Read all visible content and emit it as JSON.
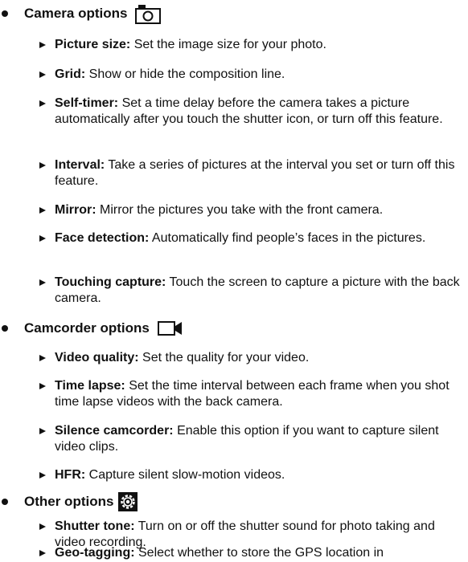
{
  "sections": [
    {
      "title": "Camera options",
      "icon": "camera-icon",
      "items": [
        {
          "label": "Picture size:",
          "text": " Set the image size for your photo."
        },
        {
          "label": "Grid:",
          "text": " Show or hide the composition line."
        },
        {
          "label": "Self-timer:",
          "text": " Set a time delay before the camera takes a picture automatically after you touch the shutter icon, or turn off this feature."
        },
        {
          "label": "Interval:",
          "text": " Take a series of pictures at the interval you set or turn off this feature."
        },
        {
          "label": "Mirror:",
          "text": " Mirror the pictures you take with the front camera."
        },
        {
          "label": "Face detection:",
          "text": " Automatically find people’s faces in the pictures."
        },
        {
          "label": "Touching capture:",
          "text": " Touch the screen to capture a picture with the back camera."
        }
      ]
    },
    {
      "title": "Camcorder options",
      "icon": "camcorder-icon",
      "items": [
        {
          "label": "Video quality:",
          "text": " Set the quality for your video."
        },
        {
          "label": "Time lapse:",
          "text": " Set the time interval between each frame when you shot time lapse videos with the back camera."
        },
        {
          "label": "Silence camcorder:",
          "text": " Enable this option if you want to capture silent video clips."
        },
        {
          "label": "HFR:",
          "text": " Capture silent slow-motion videos."
        }
      ]
    },
    {
      "title": "Other options",
      "icon": "gear-icon",
      "items": [
        {
          "label": "Shutter tone:",
          "text": " Turn on or off the shutter sound for photo taking and video recording."
        },
        {
          "label": "Geo-tagging:",
          "text": " Select whether to store the GPS location in"
        }
      ]
    }
  ]
}
